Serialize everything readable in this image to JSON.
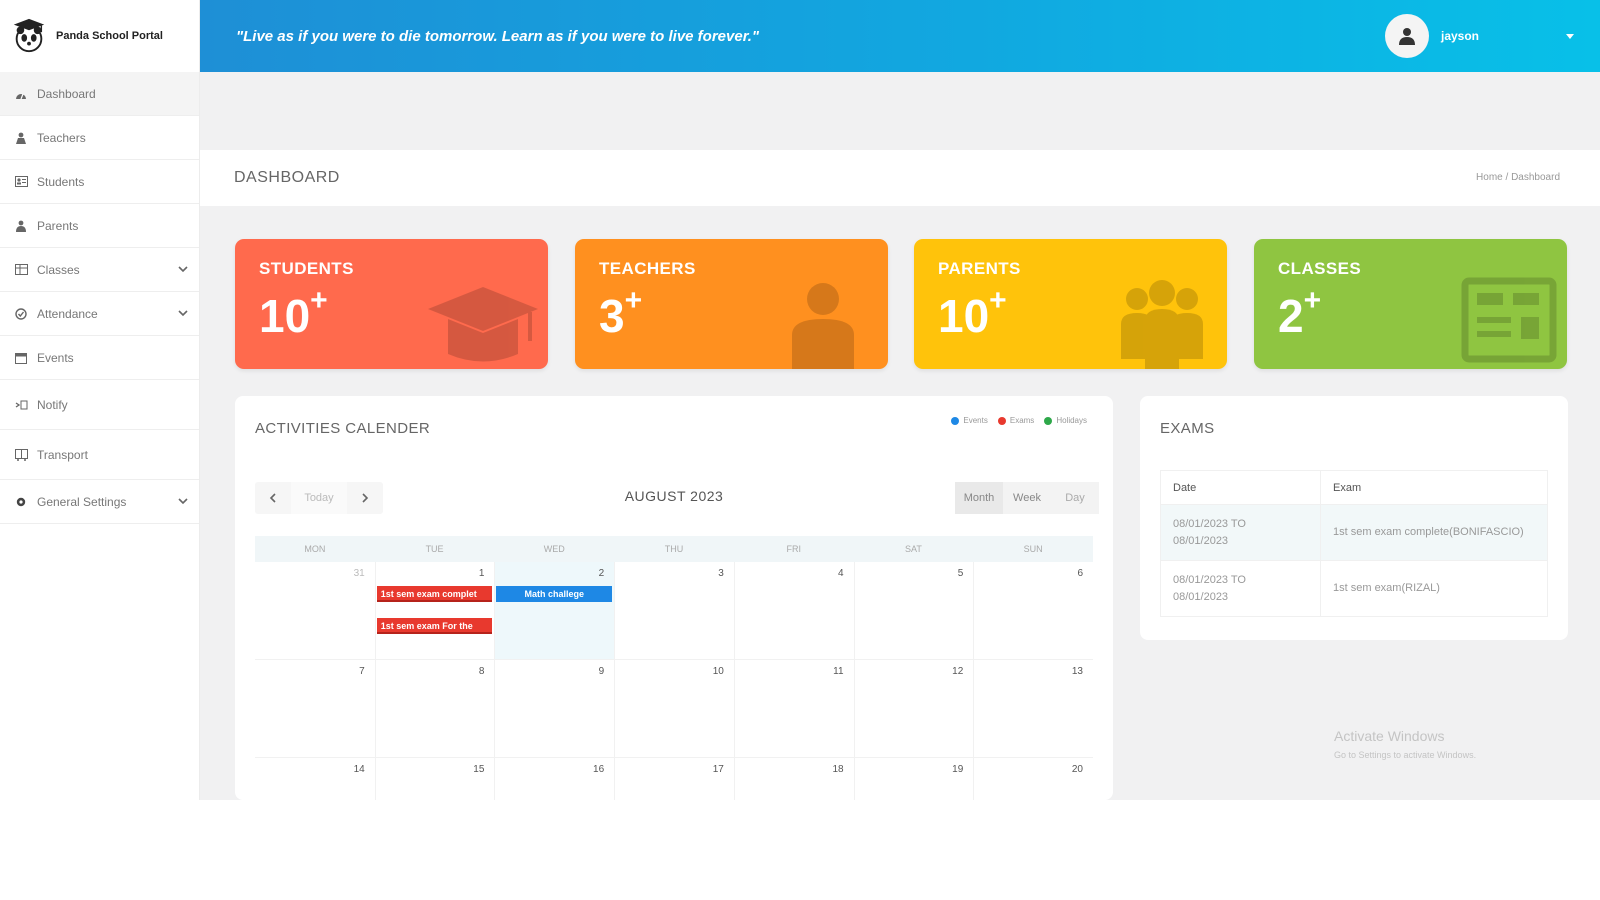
{
  "brand": {
    "name": "Panda School Portal"
  },
  "topbar": {
    "quote": "\"Live as if you were to die tomorrow. Learn as if you were to live forever.\"",
    "username": "jayson"
  },
  "sidebar": {
    "items": [
      {
        "label": "Dashboard",
        "icon": "dashboard-icon"
      },
      {
        "label": "Teachers",
        "icon": "teacher-icon"
      },
      {
        "label": "Students",
        "icon": "students-icon"
      },
      {
        "label": "Parents",
        "icon": "parents-icon"
      },
      {
        "label": "Classes",
        "icon": "classes-icon"
      },
      {
        "label": "Attendance",
        "icon": "attendance-icon"
      },
      {
        "label": "Events",
        "icon": "calendar-icon"
      },
      {
        "label": "Notify",
        "icon": "notify-icon"
      },
      {
        "label": "Transport",
        "icon": "transport-icon"
      },
      {
        "label": "General Settings",
        "icon": "gear-icon"
      }
    ]
  },
  "page": {
    "title": "DASHBOARD",
    "breadcrumb": [
      "Home",
      "Dashboard"
    ]
  },
  "cards": [
    {
      "label": "STUDENTS",
      "value": "10",
      "suffix": "+",
      "color": "#ff6a4d"
    },
    {
      "label": "TEACHERS",
      "value": "3",
      "suffix": "+",
      "color": "#ff901f"
    },
    {
      "label": "PARENTS",
      "value": "10",
      "suffix": "+",
      "color": "#ffc30b"
    },
    {
      "label": "CLASSES",
      "value": "2",
      "suffix": "+",
      "color": "#8fc541"
    }
  ],
  "calendar": {
    "title": "ACTIVITIES CALENDER",
    "legend": [
      {
        "label": "Events",
        "color": "#1e88e5"
      },
      {
        "label": "Exams",
        "color": "#e8392e"
      },
      {
        "label": "Holidays",
        "color": "#2ea84a"
      }
    ],
    "month_label": "AUGUST 2023",
    "today_label": "Today",
    "views": [
      "Month",
      "Week",
      "Day"
    ],
    "weekdays": [
      "MON",
      "TUE",
      "WED",
      "THU",
      "FRI",
      "SAT",
      "SUN"
    ],
    "weeks": [
      [
        "31",
        "1",
        "2",
        "3",
        "4",
        "5",
        "6"
      ],
      [
        "7",
        "8",
        "9",
        "10",
        "11",
        "12",
        "13"
      ],
      [
        "14",
        "15",
        "16",
        "17",
        "18",
        "19",
        "20"
      ]
    ],
    "events": [
      {
        "title": "1st sem exam complet",
        "type": "exam",
        "week": 0,
        "day": 1,
        "row": 0
      },
      {
        "title": "Math challege",
        "type": "event",
        "week": 0,
        "day": 2,
        "row": 0
      },
      {
        "title": "1st sem exam  For the",
        "type": "exam",
        "week": 0,
        "day": 1,
        "row": 1
      }
    ]
  },
  "exams": {
    "title": "EXAMS",
    "columns": [
      "Date",
      "Exam"
    ],
    "rows": [
      {
        "date_from": "08/01/2023 TO",
        "date_to": "08/01/2023",
        "exam": "1st sem exam complete(BONIFASCIO)"
      },
      {
        "date_from": "08/01/2023 TO",
        "date_to": "08/01/2023",
        "exam": "1st sem exam(RIZAL)"
      }
    ]
  },
  "watermark": {
    "line1": "Activate Windows",
    "line2": "Go to Settings to activate Windows."
  }
}
